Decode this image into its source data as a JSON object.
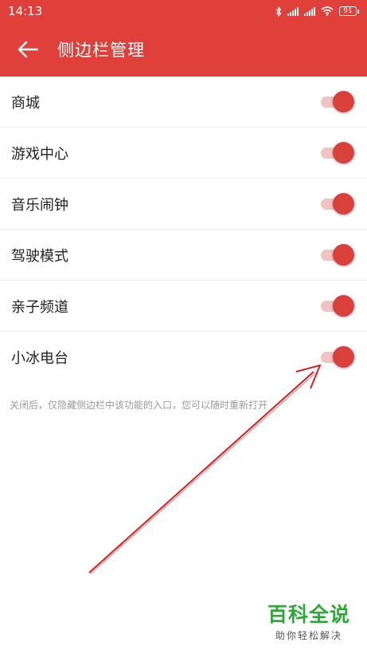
{
  "status_bar": {
    "time": "14:13",
    "battery": "91"
  },
  "header": {
    "title": "侧边栏管理",
    "back_icon": "arrow-left-icon"
  },
  "settings": [
    {
      "label": "商城",
      "enabled": true
    },
    {
      "label": "游戏中心",
      "enabled": true
    },
    {
      "label": "音乐闹钟",
      "enabled": true
    },
    {
      "label": "驾驶模式",
      "enabled": true
    },
    {
      "label": "亲子频道",
      "enabled": true
    },
    {
      "label": "小冰电台",
      "enabled": true
    }
  ],
  "note": "关闭后，仅隐藏侧边栏中该功能的入口，您可以随时重新打开",
  "watermark": {
    "title": "百科全说",
    "subtitle": "助你轻松解决"
  },
  "colors": {
    "accent": "#e0403a",
    "toggle_knob": "#d9413b",
    "toggle_track": "#f2c3c1",
    "annotation_arrow": "#d62020",
    "watermark_green": "#2fa83a"
  }
}
